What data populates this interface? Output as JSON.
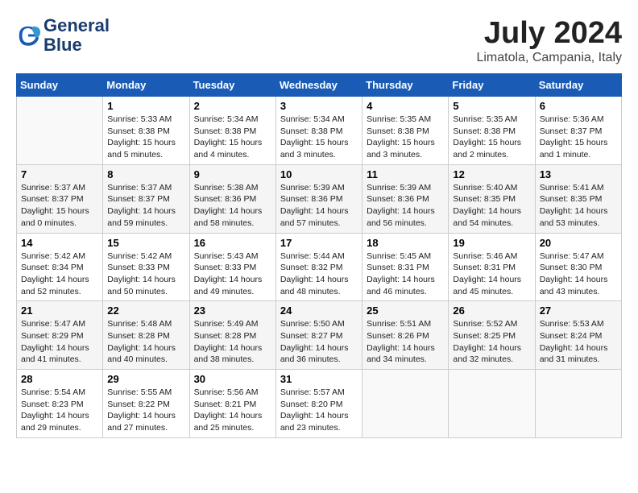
{
  "header": {
    "logo_line1": "General",
    "logo_line2": "Blue",
    "month_year": "July 2024",
    "location": "Limatola, Campania, Italy"
  },
  "weekdays": [
    "Sunday",
    "Monday",
    "Tuesday",
    "Wednesday",
    "Thursday",
    "Friday",
    "Saturday"
  ],
  "weeks": [
    [
      {
        "day": "",
        "sunrise": "",
        "sunset": "",
        "daylight": ""
      },
      {
        "day": "1",
        "sunrise": "Sunrise: 5:33 AM",
        "sunset": "Sunset: 8:38 PM",
        "daylight": "Daylight: 15 hours and 5 minutes."
      },
      {
        "day": "2",
        "sunrise": "Sunrise: 5:34 AM",
        "sunset": "Sunset: 8:38 PM",
        "daylight": "Daylight: 15 hours and 4 minutes."
      },
      {
        "day": "3",
        "sunrise": "Sunrise: 5:34 AM",
        "sunset": "Sunset: 8:38 PM",
        "daylight": "Daylight: 15 hours and 3 minutes."
      },
      {
        "day": "4",
        "sunrise": "Sunrise: 5:35 AM",
        "sunset": "Sunset: 8:38 PM",
        "daylight": "Daylight: 15 hours and 3 minutes."
      },
      {
        "day": "5",
        "sunrise": "Sunrise: 5:35 AM",
        "sunset": "Sunset: 8:38 PM",
        "daylight": "Daylight: 15 hours and 2 minutes."
      },
      {
        "day": "6",
        "sunrise": "Sunrise: 5:36 AM",
        "sunset": "Sunset: 8:37 PM",
        "daylight": "Daylight: 15 hours and 1 minute."
      }
    ],
    [
      {
        "day": "7",
        "sunrise": "Sunrise: 5:37 AM",
        "sunset": "Sunset: 8:37 PM",
        "daylight": "Daylight: 15 hours and 0 minutes."
      },
      {
        "day": "8",
        "sunrise": "Sunrise: 5:37 AM",
        "sunset": "Sunset: 8:37 PM",
        "daylight": "Daylight: 14 hours and 59 minutes."
      },
      {
        "day": "9",
        "sunrise": "Sunrise: 5:38 AM",
        "sunset": "Sunset: 8:36 PM",
        "daylight": "Daylight: 14 hours and 58 minutes."
      },
      {
        "day": "10",
        "sunrise": "Sunrise: 5:39 AM",
        "sunset": "Sunset: 8:36 PM",
        "daylight": "Daylight: 14 hours and 57 minutes."
      },
      {
        "day": "11",
        "sunrise": "Sunrise: 5:39 AM",
        "sunset": "Sunset: 8:36 PM",
        "daylight": "Daylight: 14 hours and 56 minutes."
      },
      {
        "day": "12",
        "sunrise": "Sunrise: 5:40 AM",
        "sunset": "Sunset: 8:35 PM",
        "daylight": "Daylight: 14 hours and 54 minutes."
      },
      {
        "day": "13",
        "sunrise": "Sunrise: 5:41 AM",
        "sunset": "Sunset: 8:35 PM",
        "daylight": "Daylight: 14 hours and 53 minutes."
      }
    ],
    [
      {
        "day": "14",
        "sunrise": "Sunrise: 5:42 AM",
        "sunset": "Sunset: 8:34 PM",
        "daylight": "Daylight: 14 hours and 52 minutes."
      },
      {
        "day": "15",
        "sunrise": "Sunrise: 5:42 AM",
        "sunset": "Sunset: 8:33 PM",
        "daylight": "Daylight: 14 hours and 50 minutes."
      },
      {
        "day": "16",
        "sunrise": "Sunrise: 5:43 AM",
        "sunset": "Sunset: 8:33 PM",
        "daylight": "Daylight: 14 hours and 49 minutes."
      },
      {
        "day": "17",
        "sunrise": "Sunrise: 5:44 AM",
        "sunset": "Sunset: 8:32 PM",
        "daylight": "Daylight: 14 hours and 48 minutes."
      },
      {
        "day": "18",
        "sunrise": "Sunrise: 5:45 AM",
        "sunset": "Sunset: 8:31 PM",
        "daylight": "Daylight: 14 hours and 46 minutes."
      },
      {
        "day": "19",
        "sunrise": "Sunrise: 5:46 AM",
        "sunset": "Sunset: 8:31 PM",
        "daylight": "Daylight: 14 hours and 45 minutes."
      },
      {
        "day": "20",
        "sunrise": "Sunrise: 5:47 AM",
        "sunset": "Sunset: 8:30 PM",
        "daylight": "Daylight: 14 hours and 43 minutes."
      }
    ],
    [
      {
        "day": "21",
        "sunrise": "Sunrise: 5:47 AM",
        "sunset": "Sunset: 8:29 PM",
        "daylight": "Daylight: 14 hours and 41 minutes."
      },
      {
        "day": "22",
        "sunrise": "Sunrise: 5:48 AM",
        "sunset": "Sunset: 8:28 PM",
        "daylight": "Daylight: 14 hours and 40 minutes."
      },
      {
        "day": "23",
        "sunrise": "Sunrise: 5:49 AM",
        "sunset": "Sunset: 8:28 PM",
        "daylight": "Daylight: 14 hours and 38 minutes."
      },
      {
        "day": "24",
        "sunrise": "Sunrise: 5:50 AM",
        "sunset": "Sunset: 8:27 PM",
        "daylight": "Daylight: 14 hours and 36 minutes."
      },
      {
        "day": "25",
        "sunrise": "Sunrise: 5:51 AM",
        "sunset": "Sunset: 8:26 PM",
        "daylight": "Daylight: 14 hours and 34 minutes."
      },
      {
        "day": "26",
        "sunrise": "Sunrise: 5:52 AM",
        "sunset": "Sunset: 8:25 PM",
        "daylight": "Daylight: 14 hours and 32 minutes."
      },
      {
        "day": "27",
        "sunrise": "Sunrise: 5:53 AM",
        "sunset": "Sunset: 8:24 PM",
        "daylight": "Daylight: 14 hours and 31 minutes."
      }
    ],
    [
      {
        "day": "28",
        "sunrise": "Sunrise: 5:54 AM",
        "sunset": "Sunset: 8:23 PM",
        "daylight": "Daylight: 14 hours and 29 minutes."
      },
      {
        "day": "29",
        "sunrise": "Sunrise: 5:55 AM",
        "sunset": "Sunset: 8:22 PM",
        "daylight": "Daylight: 14 hours and 27 minutes."
      },
      {
        "day": "30",
        "sunrise": "Sunrise: 5:56 AM",
        "sunset": "Sunset: 8:21 PM",
        "daylight": "Daylight: 14 hours and 25 minutes."
      },
      {
        "day": "31",
        "sunrise": "Sunrise: 5:57 AM",
        "sunset": "Sunset: 8:20 PM",
        "daylight": "Daylight: 14 hours and 23 minutes."
      },
      {
        "day": "",
        "sunrise": "",
        "sunset": "",
        "daylight": ""
      },
      {
        "day": "",
        "sunrise": "",
        "sunset": "",
        "daylight": ""
      },
      {
        "day": "",
        "sunrise": "",
        "sunset": "",
        "daylight": ""
      }
    ]
  ]
}
